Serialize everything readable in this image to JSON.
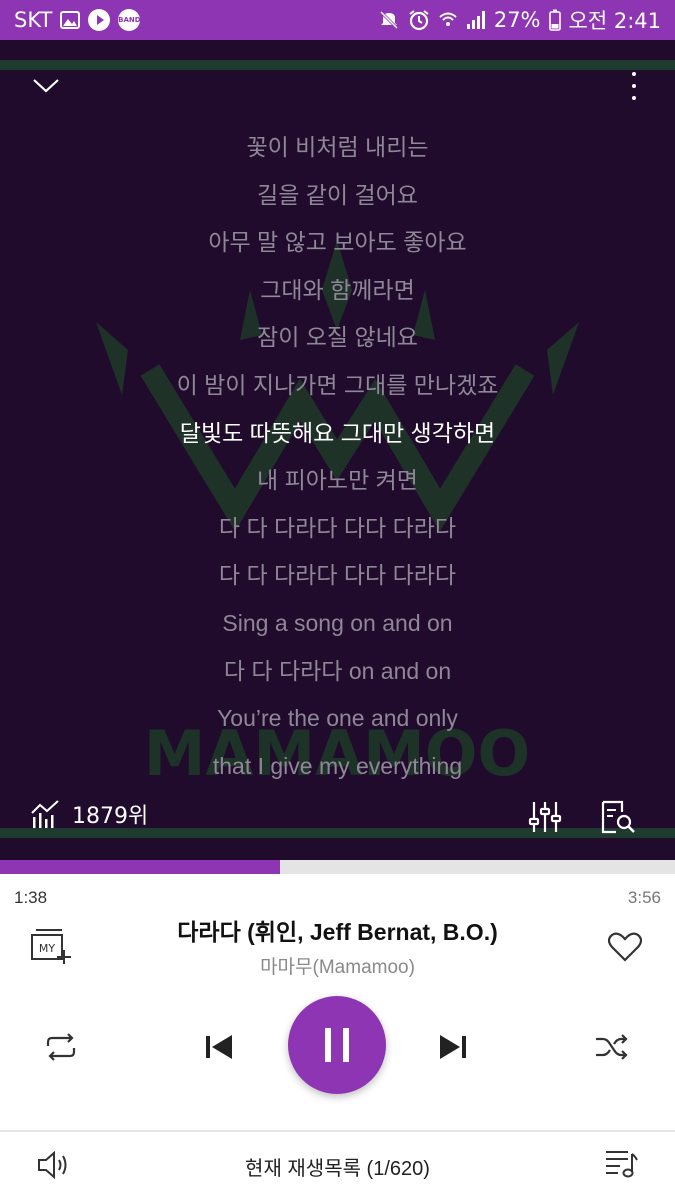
{
  "status_bar": {
    "carrier": "SKT",
    "band_label": "BAND",
    "battery": "27%",
    "time": "오전 2:41",
    "background": "#8e35b4"
  },
  "lyrics": {
    "lines": [
      "꽃이 비처럼 내리는",
      "길을 같이 걸어요",
      "아무 말 않고 보아도 좋아요",
      "그대와 함께라면",
      "잠이 오질 않네요",
      "이 밤이 지나가면 그대를 만나겠죠",
      "달빛도 따뜻해요 그대만 생각하면",
      "내 피아노만 켜면",
      "다 다 다라다 다다 다라다",
      "다 다 다라다 다다 다라다",
      "Sing a song on and on",
      "다 다 다라다 on and on",
      "You’re the one and only",
      "that I give my everything"
    ],
    "active_index": 6,
    "background": "#200b2c"
  },
  "chart": {
    "rank": "1879위"
  },
  "player": {
    "progress": 0.415,
    "elapsed": "1:38",
    "total": "3:56",
    "title": "다라다 (휘인, Jeff Bernat, B.O.)",
    "artist": "마마무(Mamamoo)",
    "my_label": "MY",
    "accent": "#8e35b4"
  },
  "footer": {
    "playlist": "현재 재생목록 (1/620)"
  }
}
